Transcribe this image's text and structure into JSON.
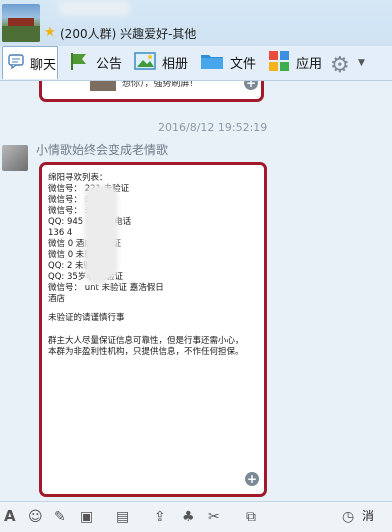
{
  "header": {
    "group_title": "(200人群) 兴趣爱好-其他"
  },
  "toolbar": {
    "tabs": [
      {
        "label": "聊天",
        "icon": "chat-icon"
      },
      {
        "label": "公告",
        "icon": "flag-icon"
      },
      {
        "label": "相册",
        "icon": "photo-icon"
      },
      {
        "label": "文件",
        "icon": "folder-icon"
      },
      {
        "label": "应用",
        "icon": "apps-icon"
      }
    ],
    "settings_icon": "gear-icon"
  },
  "chat": {
    "previous_message_text": "想你），强势刷屏!",
    "timestamp": "2016/8/12 19:52:19",
    "sender_name": "小情歌始终会变成老情歌",
    "message_lines": [
      "绵阳寻欢列表：",
      "微信号：        221          未验证",
      "微信号：                     未验证",
      "微信号：                     未验证",
      "QQ:         945        已验证   电话",
      "136          4",
      "微信           0     酒店    未验证",
      "微信           0              未验证",
      "QQ:  2                        未验证",
      "QQ:            35岁老   已验证",
      "微信号：        unt       未验证   嘉浩假日",
      "酒店",
      "",
      "未验证的请谨慎行事",
      "",
      "群主大人尽量保证信息可靠性，但是行事还需小心，",
      "本群为非盈利性机构，只提供信息，不作任何担保。"
    ]
  },
  "bottom_toolbar": {
    "icons": [
      "font-icon",
      "emoji-icon",
      "magic-icon",
      "gift-icon",
      "image-icon",
      "upload-icon",
      "bag-icon",
      "scissors-icon",
      "screenshot-icon"
    ],
    "message_label": "消"
  },
  "colors": {
    "bubble_border": "#a01a2c",
    "background": "#e9f1f8",
    "timestamp": "#8a99a6"
  }
}
